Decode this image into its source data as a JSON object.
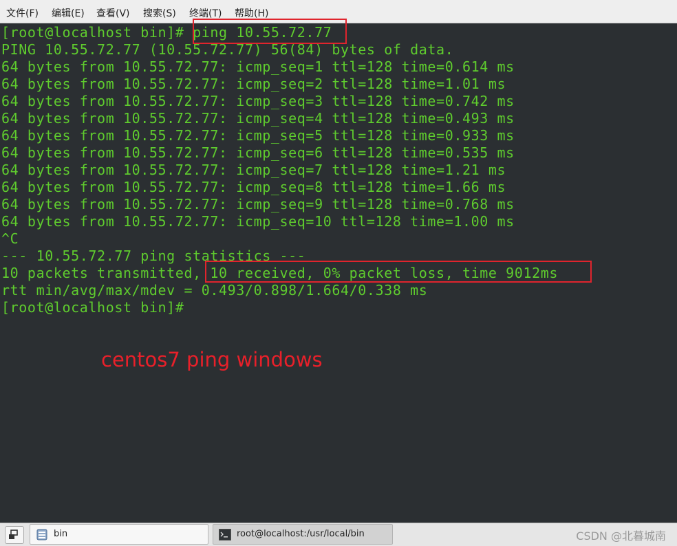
{
  "menu": {
    "items": [
      "文件(F)",
      "编辑(E)",
      "查看(V)",
      "搜索(S)",
      "终端(T)",
      "帮助(H)"
    ]
  },
  "terminal": {
    "text_color": "#5fcc2e",
    "background": "#2b2f32",
    "lines": [
      "[root@localhost bin]# ping 10.55.72.77",
      "PING 10.55.72.77 (10.55.72.77) 56(84) bytes of data.",
      "64 bytes from 10.55.72.77: icmp_seq=1 ttl=128 time=0.614 ms",
      "64 bytes from 10.55.72.77: icmp_seq=2 ttl=128 time=1.01 ms",
      "64 bytes from 10.55.72.77: icmp_seq=3 ttl=128 time=0.742 ms",
      "64 bytes from 10.55.72.77: icmp_seq=4 ttl=128 time=0.493 ms",
      "64 bytes from 10.55.72.77: icmp_seq=5 ttl=128 time=0.933 ms",
      "64 bytes from 10.55.72.77: icmp_seq=6 ttl=128 time=0.535 ms",
      "64 bytes from 10.55.72.77: icmp_seq=7 ttl=128 time=1.21 ms",
      "64 bytes from 10.55.72.77: icmp_seq=8 ttl=128 time=1.66 ms",
      "64 bytes from 10.55.72.77: icmp_seq=9 ttl=128 time=0.768 ms",
      "64 bytes from 10.55.72.77: icmp_seq=10 ttl=128 time=1.00 ms",
      "^C",
      "--- 10.55.72.77 ping statistics ---",
      "10 packets transmitted, 10 received, 0% packet loss, time 9012ms",
      "rtt min/avg/max/mdev = 0.493/0.898/1.664/0.338 ms",
      "[root@localhost bin]#"
    ]
  },
  "annotation": {
    "text": "centos7 ping windows",
    "color": "#e8202a"
  },
  "highlight_color": "#e0242d",
  "taskbar": {
    "tasks": [
      {
        "label": "bin",
        "icon": "folder-icon"
      },
      {
        "label": "root@localhost:/usr/local/bin",
        "icon": "terminal-icon"
      }
    ],
    "watermark": "CSDN @北暮城南"
  }
}
